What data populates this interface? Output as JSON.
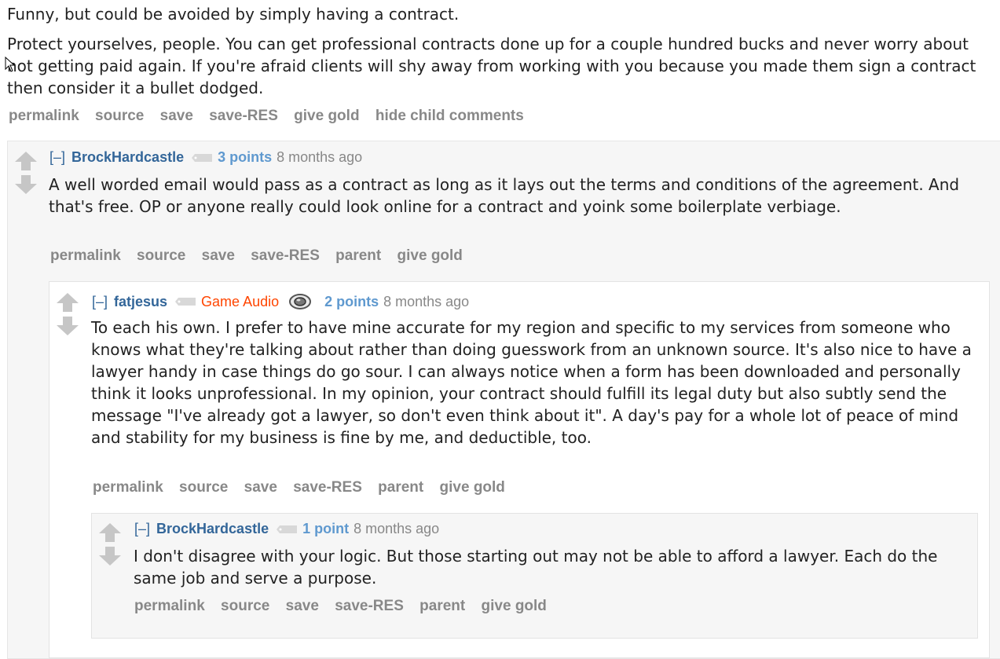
{
  "top_comment": {
    "paragraphs": [
      "Funny, but could be avoided by simply having a contract.",
      "Protect yourselves, people. You can get professional contracts done up for a couple hundred bucks and never worry about not getting paid again. If you're afraid clients will shy away from working with you because you made them sign a contract then consider it a bullet dodged."
    ],
    "buttons": [
      "permalink",
      "source",
      "save",
      "save-RES",
      "give gold",
      "hide child comments"
    ]
  },
  "comment1": {
    "expand": "[–]",
    "author": "BrockHardcastle",
    "score": "3 points",
    "time": "8 months ago",
    "body": "A well worded email would pass as a contract as long as it lays out the terms and conditions of the agreement. And that's free. OP or anyone really could look online for a contract and yoink some boilerplate verbiage.",
    "buttons": [
      "permalink",
      "source",
      "save",
      "save-RES",
      "parent",
      "give gold"
    ]
  },
  "comment2": {
    "expand": "[–]",
    "author": "fatjesus",
    "flair": "Game Audio",
    "flair_icon": "speaker-icon",
    "score": "2 points",
    "time": "8 months ago",
    "body": "To each his own. I prefer to have mine accurate for my region and specific to my services from someone who knows what they're talking about rather than doing guesswork from an unknown source. It's also nice to have a lawyer handy in case things do go sour. I can always notice when a form has been downloaded and personally think it looks unprofessional. In my opinion, your contract should fulfill its legal duty but also subtly send the message \"I've already got a lawyer, so don't even think about it\". A day's pay for a whole lot of peace of mind and stability for my business is fine by me, and deductible, too.",
    "buttons": [
      "permalink",
      "source",
      "save",
      "save-RES",
      "parent",
      "give gold"
    ]
  },
  "comment3": {
    "expand": "[–]",
    "author": "BrockHardcastle",
    "score": "1 point",
    "time": "8 months ago",
    "body": "I don't disagree with your logic. But those starting out may not be able to afford a lawyer. Each do the same job and serve a purpose.",
    "buttons": [
      "permalink",
      "source",
      "save",
      "save-RES",
      "parent",
      "give gold"
    ]
  },
  "colors": {
    "author": "#336699",
    "score": "#5f99cf",
    "flair": "#ff4500",
    "buttons": "#888888"
  }
}
